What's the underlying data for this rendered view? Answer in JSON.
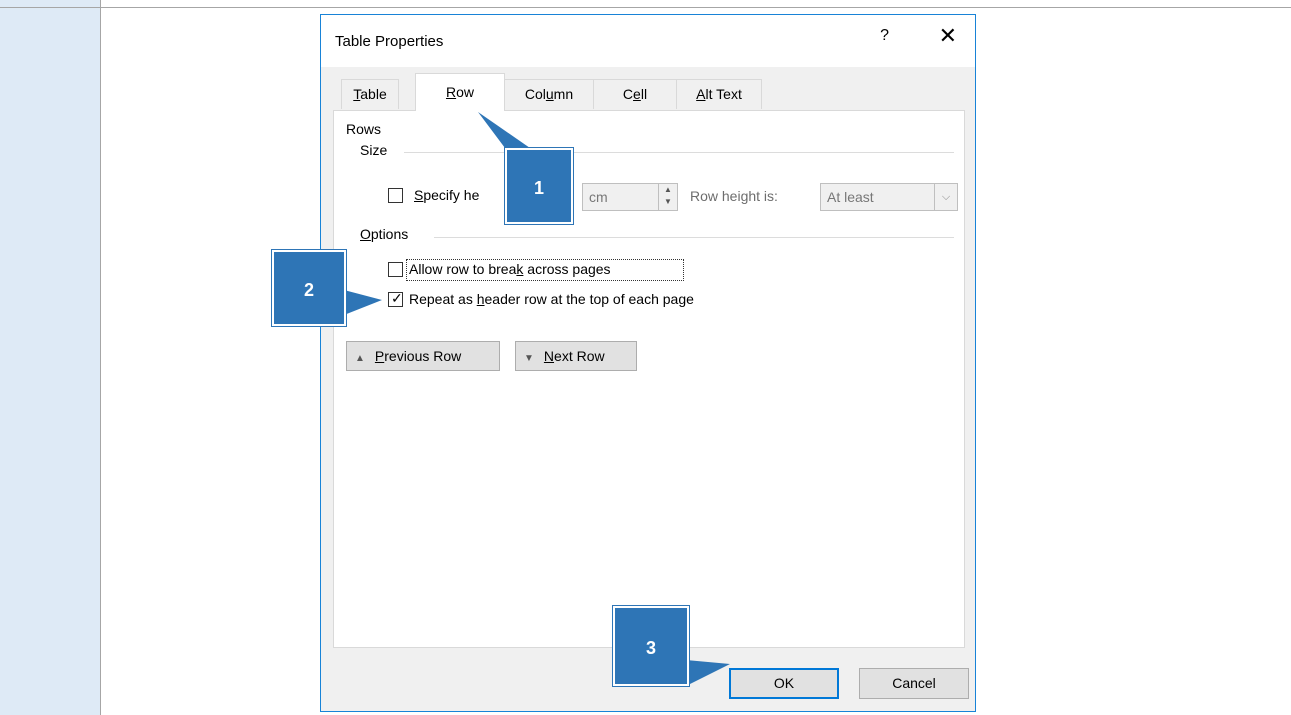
{
  "dialog": {
    "title": "Table Properties",
    "help": "?",
    "close": "✕",
    "tabs": [
      {
        "label": "Table",
        "accel": "T",
        "rest": "able"
      },
      {
        "label": "Row",
        "accel": "R",
        "rest": "ow"
      },
      {
        "label": "Column",
        "pre": "Col",
        "accel": "u",
        "rest": "mn"
      },
      {
        "label": "Cell",
        "pre": "C",
        "accel": "e",
        "rest": "ll"
      },
      {
        "label": "Alt Text",
        "accel": "A",
        "rest": "lt Text"
      }
    ],
    "active_tab": "Row"
  },
  "rows": {
    "section": "Rows",
    "size": {
      "heading": "Size",
      "specify_height_pre": "",
      "specify_height_accel": "S",
      "specify_height_rest": "pecify he",
      "specify_height_checked": false,
      "height_unit": "cm",
      "row_height_is_label": "Row height is:",
      "row_height_is_value": "At least"
    },
    "options": {
      "heading_accel": "O",
      "heading_rest": "ptions",
      "allow_break_pre": "Allow row to brea",
      "allow_break_accel": "k",
      "allow_break_rest": " across pages",
      "allow_break_checked": false,
      "repeat_header_pre": "Repeat as ",
      "repeat_header_accel": "h",
      "repeat_header_rest": "eader row at the top of each page",
      "repeat_header_checked": true
    },
    "prev_accel": "P",
    "prev_rest": "revious Row",
    "next_accel": "N",
    "next_rest": "ext Row"
  },
  "footer": {
    "ok": "OK",
    "cancel": "Cancel"
  },
  "callouts": [
    "1",
    "2",
    "3"
  ],
  "colors": {
    "callout": "#2e75b6",
    "dialog_border": "#1883d7",
    "left_band": "#deeaf6"
  }
}
